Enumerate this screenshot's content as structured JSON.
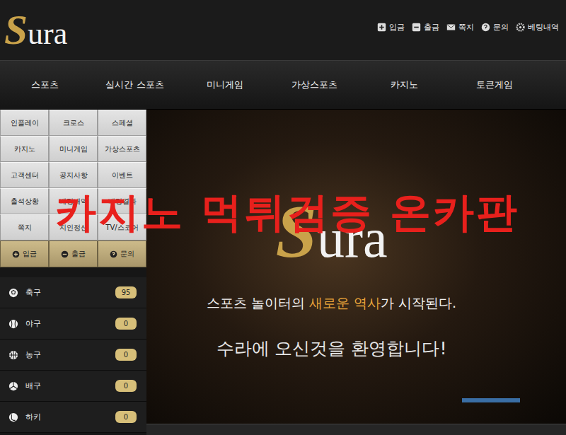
{
  "header": {
    "logo": {
      "initial": "S",
      "rest": "ura"
    },
    "links": [
      {
        "label": "입금"
      },
      {
        "label": "출금"
      },
      {
        "label": "쪽지"
      },
      {
        "label": "문의"
      },
      {
        "label": "베팅내역"
      }
    ]
  },
  "nav": [
    {
      "label": "스포츠"
    },
    {
      "label": "실시간 스포츠"
    },
    {
      "label": "미니게임"
    },
    {
      "label": "가상스포츠"
    },
    {
      "label": "카지노"
    },
    {
      "label": "토큰게임"
    }
  ],
  "sidebar": {
    "menu": [
      {
        "label": "인플레이"
      },
      {
        "label": "크로스"
      },
      {
        "label": "스페셜"
      },
      {
        "label": "카지노"
      },
      {
        "label": "미니게임"
      },
      {
        "label": "가상스포츠"
      },
      {
        "label": "고객센터"
      },
      {
        "label": "공지사항"
      },
      {
        "label": "이벤트"
      },
      {
        "label": "출석상황"
      },
      {
        "label": "베팅내역"
      },
      {
        "label": "베팅결과"
      },
      {
        "label": "쪽지"
      },
      {
        "label": "지인정산"
      },
      {
        "label": "TV/스코어"
      }
    ],
    "actions": [
      {
        "label": "입금"
      },
      {
        "label": "출금"
      },
      {
        "label": "문의"
      }
    ],
    "sports": [
      {
        "name": "축구",
        "count": "95"
      },
      {
        "name": "야구",
        "count": "0"
      },
      {
        "name": "농구",
        "count": "0"
      },
      {
        "name": "배구",
        "count": "0"
      },
      {
        "name": "하키",
        "count": "0"
      }
    ]
  },
  "banner": {
    "logo": {
      "initial": "S",
      "rest": "ura"
    },
    "tagline": [
      {
        "text": "스포츠 놀이터의 ",
        "highlight": false
      },
      {
        "text": "새로운 역사",
        "highlight": true
      },
      {
        "text": "가 시작된다.",
        "highlight": false
      }
    ],
    "welcome": "수라에 오신것을 환영합니다!",
    "slides": [
      {
        "selected": true
      }
    ]
  },
  "watermark": "카지노 먹튀검증 온카판"
}
